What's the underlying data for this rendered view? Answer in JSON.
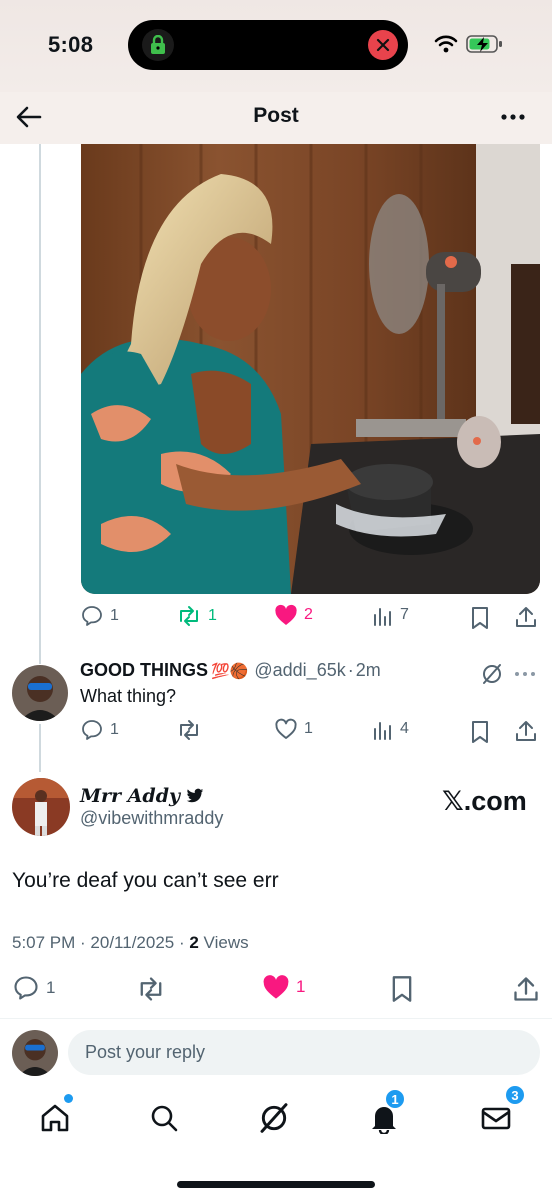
{
  "status_bar": {
    "time": "5:08"
  },
  "header": {
    "title": "Post"
  },
  "quoted_post": {
    "stats": {
      "replies": "1",
      "reposts": "1",
      "likes": "2",
      "views": "7"
    }
  },
  "reply": {
    "name": "GOOD THINGS",
    "name_emoji": "💯🏀",
    "handle": "@addi_65k",
    "sep": "·",
    "time": "2m",
    "text": "What thing?",
    "stats": {
      "replies": "1",
      "reposts": "",
      "likes": "1",
      "views": "4"
    }
  },
  "main_post": {
    "name": "Mrr Addy",
    "handle": "@vibewithmraddy",
    "watermark": "𝕏.com",
    "text": "You’re deaf you can’t see err",
    "timestamp": "5:07 PM · 20/11/2025 · ",
    "views_count": "2",
    "views_label": " Views",
    "stats": {
      "replies": "1",
      "likes": "1"
    }
  },
  "composer": {
    "placeholder": "Post your reply"
  },
  "tab_bar": {
    "items": [
      "home",
      "search",
      "grok",
      "notifications",
      "messages"
    ],
    "notifications_badge": "1",
    "messages_badge": "3"
  },
  "colors": {
    "like": "#f91880",
    "repost": "#00ba7c",
    "accent": "#1d9bf0",
    "muted": "#536471"
  }
}
